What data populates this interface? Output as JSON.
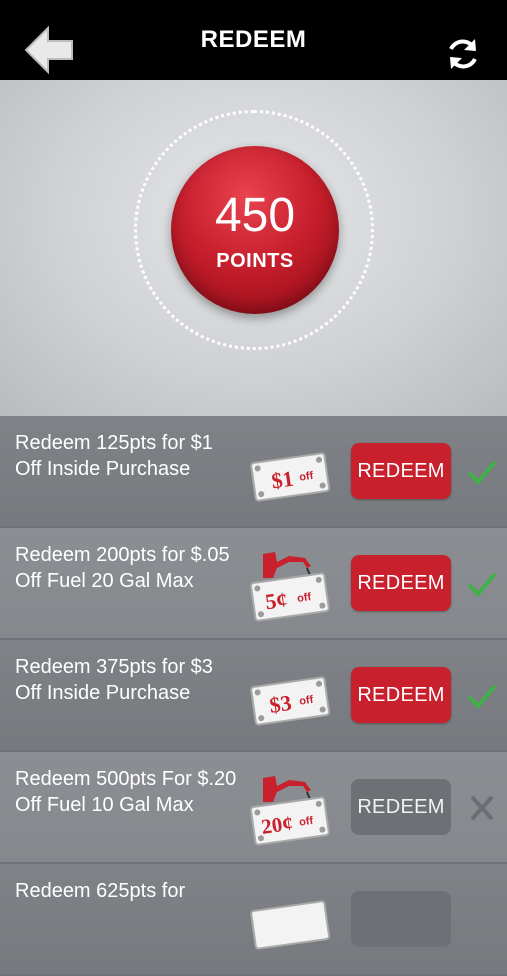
{
  "header": {
    "title": "REDEEM"
  },
  "points": {
    "value": "450",
    "label": "POINTS"
  },
  "offers": [
    {
      "text": "Redeem 125pts for $1 Off Inside Purchase",
      "coupon_label": "$1",
      "coupon_suffix": "off",
      "fuel": false,
      "button_label": "REDEEM",
      "available": true
    },
    {
      "text": "Redeem 200pts for $.05 Off Fuel 20 Gal Max",
      "coupon_label": "5¢",
      "coupon_suffix": "off",
      "fuel": true,
      "button_label": "REDEEM",
      "available": true
    },
    {
      "text": "Redeem 375pts for $3 Off Inside Purchase",
      "coupon_label": "$3",
      "coupon_suffix": "off",
      "fuel": false,
      "button_label": "REDEEM",
      "available": true
    },
    {
      "text": "Redeem 500pts For $.20 Off Fuel 10 Gal Max",
      "coupon_label": "20¢",
      "coupon_suffix": "off",
      "fuel": true,
      "button_label": "REDEEM",
      "available": false
    },
    {
      "text": "Redeem 625pts for",
      "coupon_label": "",
      "coupon_suffix": "",
      "fuel": false,
      "button_label": "",
      "available": false
    }
  ],
  "icons": {
    "back": "back-arrow-icon",
    "refresh": "refresh-icon",
    "available": "check-icon",
    "unavailable": "x-icon"
  },
  "colors": {
    "accent_red": "#c8212d",
    "check_green": "#3fb04a",
    "disabled_gray": "#6d7074"
  }
}
